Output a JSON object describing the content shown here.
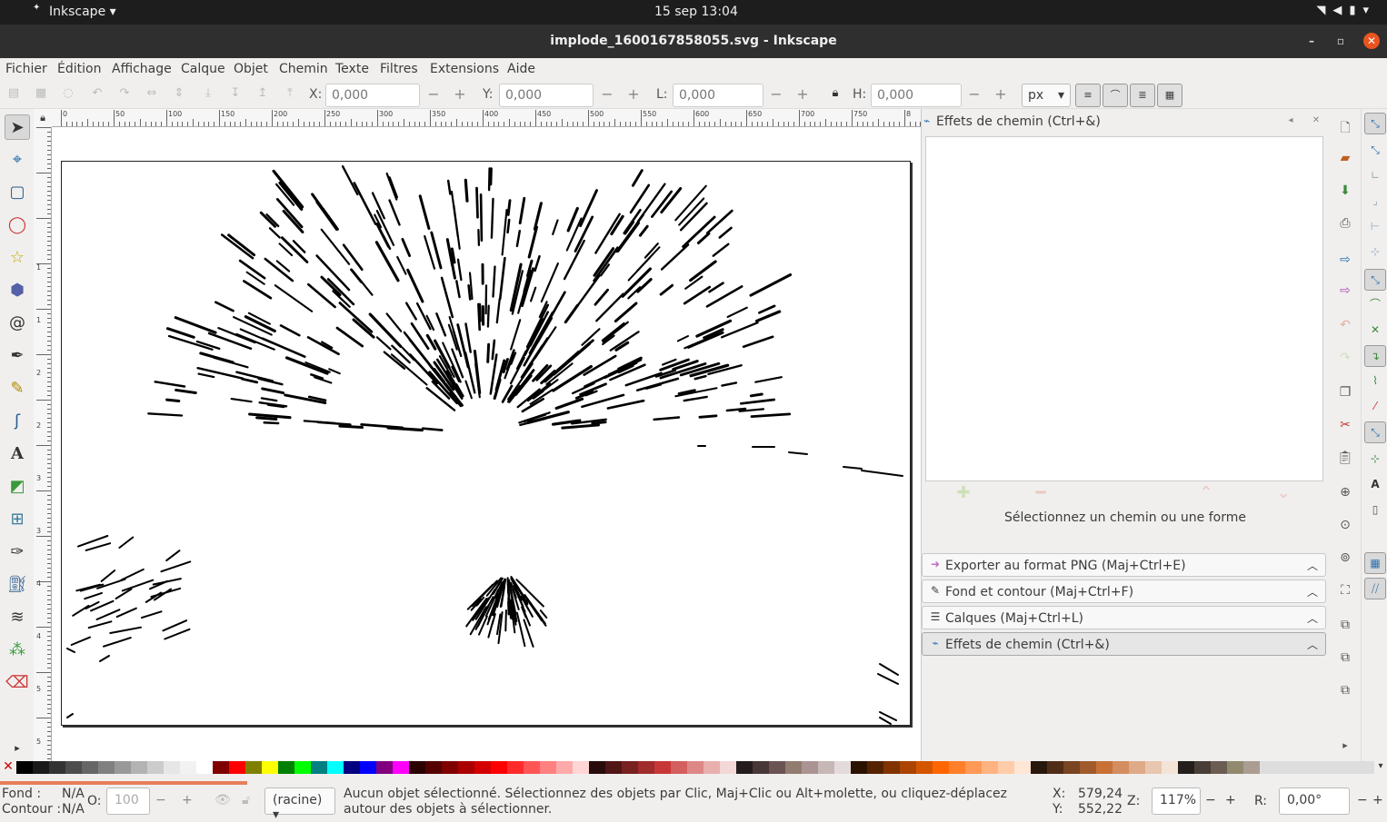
{
  "system": {
    "app_menu": "Inkscape",
    "clock": "15 sep  13:04"
  },
  "window": {
    "title": "implode_1600167858055.svg - Inkscape",
    "minimize": "–",
    "maximize": "▫",
    "close": "✕"
  },
  "menu": [
    "Fichier",
    "Édition",
    "Affichage",
    "Calque",
    "Objet",
    "Chemin",
    "Texte",
    "Filtres",
    "Extensions",
    "Aide"
  ],
  "controls": {
    "x_label": "X:",
    "x_value": "0,000",
    "y_label": "Y:",
    "y_value": "0,000",
    "w_label": "L:",
    "w_value": "0,000",
    "h_label": "H:",
    "h_value": "0,000",
    "unit": "px",
    "minus": "−",
    "plus": "+"
  },
  "ruler": {
    "h_ticks": [
      "0",
      "50",
      "100",
      "150",
      "200",
      "250",
      "300",
      "350",
      "400",
      "450",
      "500",
      "550",
      "600",
      "650",
      "700",
      "750",
      "8"
    ],
    "v_ticks": [
      "1",
      "1",
      "2",
      "2",
      "3",
      "3",
      "4",
      "4",
      "5",
      "5"
    ]
  },
  "dock": {
    "title": "Effets de chemin (Ctrl+&)",
    "empty_message": "Sélectionnez un chemin ou une forme",
    "sections": [
      {
        "label": "Exporter au format PNG (Maj+Ctrl+E)",
        "icon": "export-png-icon"
      },
      {
        "label": "Fond et contour (Maj+Ctrl+F)",
        "icon": "fill-stroke-icon"
      },
      {
        "label": "Calques (Maj+Ctrl+L)",
        "icon": "layers-icon"
      },
      {
        "label": "Effets de chemin (Ctrl+&)",
        "icon": "path-effects-icon"
      }
    ]
  },
  "palette": [
    "#000000",
    "#1a1a1a",
    "#333333",
    "#4d4d4d",
    "#666666",
    "#808080",
    "#999999",
    "#b3b3b3",
    "#cccccc",
    "#e6e6e6",
    "#f2f2f2",
    "#ffffff",
    "#800000",
    "#ff0000",
    "#808000",
    "#ffff00",
    "#008000",
    "#00ff00",
    "#008080",
    "#00ffff",
    "#000080",
    "#0000ff",
    "#800080",
    "#ff00ff",
    "#2b0000",
    "#550000",
    "#800000",
    "#aa0000",
    "#d40000",
    "#ff0000",
    "#ff2a2a",
    "#ff5555",
    "#ff8080",
    "#ffaaaa",
    "#ffd5d5",
    "#280b0b",
    "#501616",
    "#782121",
    "#a02c2c",
    "#c83737",
    "#d35f5f",
    "#de8787",
    "#e9afaf",
    "#f4d7d7",
    "#241c1c",
    "#483737",
    "#6c5353",
    "#917c6f",
    "#ac9393",
    "#c8b7b7",
    "#e3dbdb",
    "#2b1100",
    "#552200",
    "#803300",
    "#aa4400",
    "#d45500",
    "#ff6600",
    "#ff7f2a",
    "#ff9955",
    "#ffb380",
    "#ffccaa",
    "#ffe6d5",
    "#28170b",
    "#502d16",
    "#784421",
    "#a05a2c",
    "#c87137",
    "#d38d5f",
    "#deaa87",
    "#e9c6af",
    "#f4e3d7",
    "#241f1c",
    "#483e37",
    "#6c5d53",
    "#918a6f",
    "#ac9d93"
  ],
  "status": {
    "fill_label": "Fond :",
    "fill_value": "N/A",
    "stroke_label": "Contour :",
    "stroke_value": "N/A",
    "opacity_label": "O:",
    "opacity_value": "100",
    "layer": "(racine)",
    "message": "Aucun objet sélectionné. Sélectionnez des objets par Clic, Maj+Clic ou Alt+molette, ou cliquez-déplacez autour des objets à sélectionner.",
    "x_label": "X:",
    "x_value": "579,24",
    "y_label": "Y:",
    "y_value": "552,22",
    "zoom_label": "Z:",
    "zoom_value": "117%",
    "rot_label": "R:",
    "rot_value": "0,00°"
  }
}
